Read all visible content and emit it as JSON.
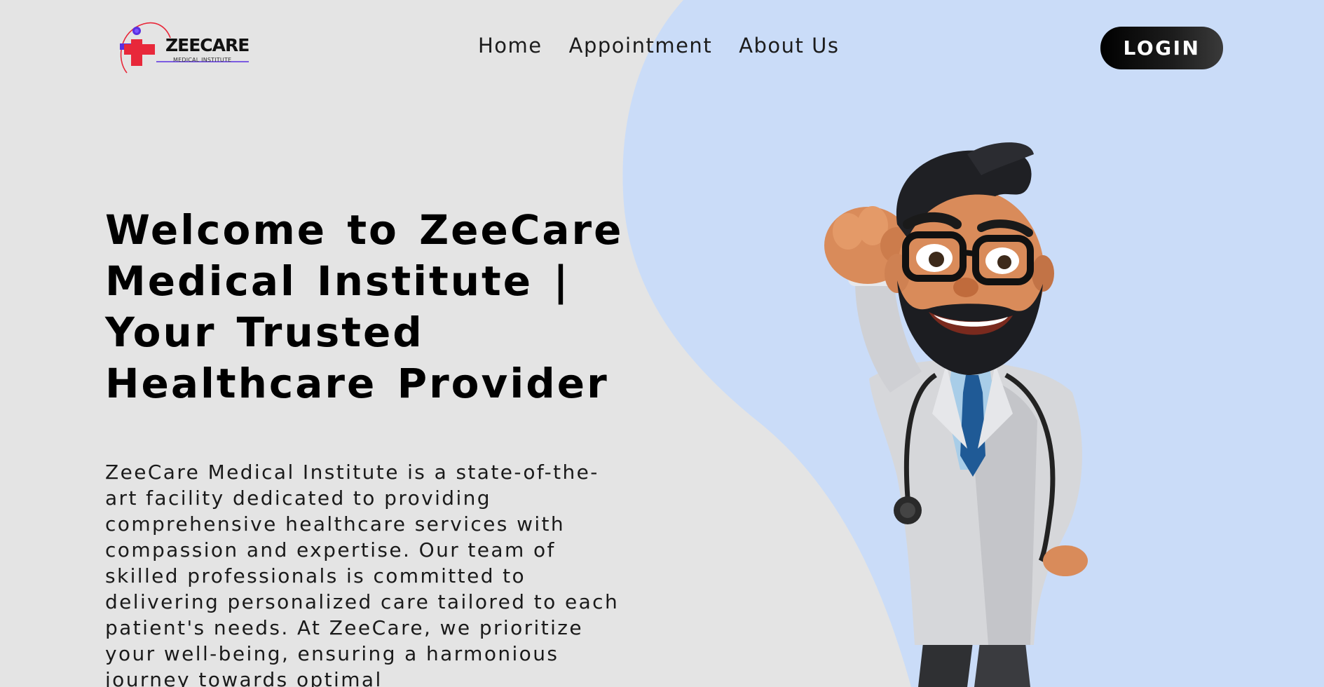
{
  "brand": {
    "logo_text": "ZEECARE",
    "logo_subtext": "MEDICAL INSTITUTE"
  },
  "nav": {
    "links": [
      "Home",
      "Appointment",
      "About Us"
    ],
    "login_label": "LOGIN"
  },
  "hero": {
    "title": "Welcome to ZeeCare Medical Institute | Your Trusted Healthcare Provider",
    "description": "ZeeCare Medical Institute is a state-of-the-art facility dedicated to providing comprehensive healthcare services with compassion and expertise. Our team of skilled professionals is committed to delivering personalized care tailored to each patient's needs. At ZeeCare, we prioritize your well-being, ensuring a harmonious journey towards optimal"
  },
  "colors": {
    "background": "#e4e4e4",
    "blob": "#cadcf8",
    "button": "#111111",
    "logo_red": "#e8283a",
    "logo_purple": "#5a2fe0"
  },
  "icons": {
    "logo": "medical-cross-logo",
    "hero_image": "doctor-illustration"
  }
}
